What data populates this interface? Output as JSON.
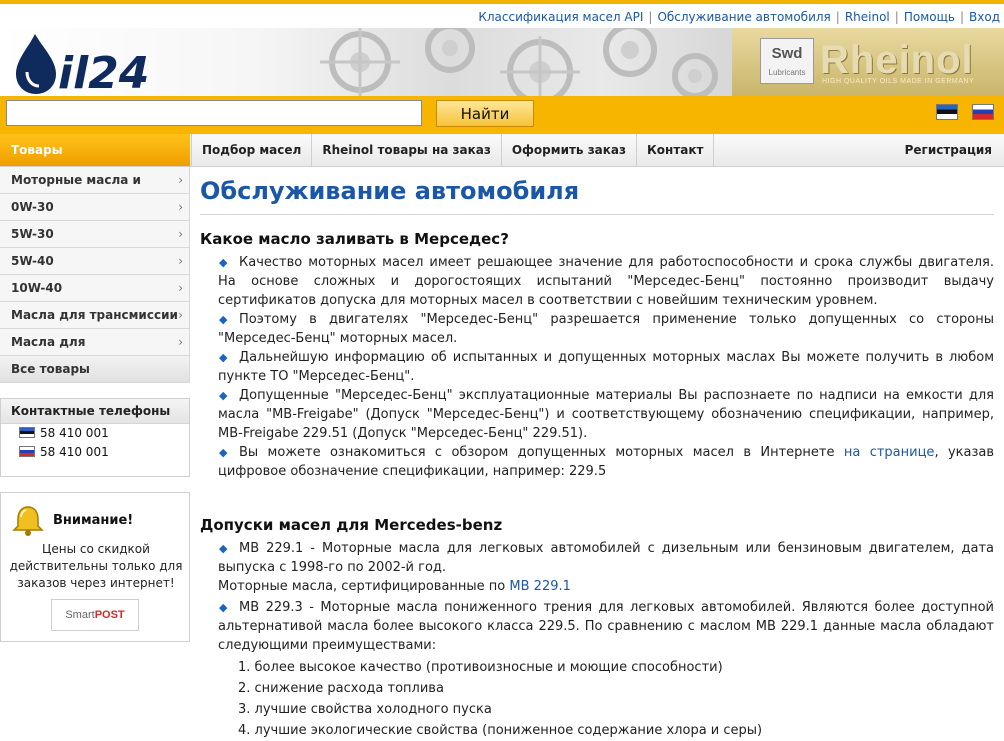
{
  "top_links": [
    "Классификация масел API",
    "Обслуживание автомобиля",
    "Rheinol",
    "Помощь",
    "Вход"
  ],
  "header": {
    "logo_text": "il24",
    "brand_box": "Swd",
    "brand_box_sub": "Lubricants",
    "brand_word": "Rheinol",
    "brand_tagline": "HIGH QUALITY OILS MADE IN GERMANY"
  },
  "search": {
    "value": "",
    "button_label": "Найти"
  },
  "nav": {
    "category_label": "Товары",
    "items": [
      "Подбор масел",
      "Rheinol товары на заказ",
      "Оформить заказ",
      "Контакт"
    ],
    "register_label": "Регистрация"
  },
  "sidebar": {
    "items": [
      "Моторные масла и смазки",
      "0W-30",
      "5W-30",
      "5W-40",
      "10W-40",
      "Масла для трансмиссии",
      "Масла для автоматической"
    ],
    "all_label": "Все товары",
    "chevron": "›"
  },
  "contacts": {
    "title": "Контактные телефоны",
    "phones": [
      "58 410 001",
      "58 410 001"
    ]
  },
  "notice": {
    "title": "Внимание!",
    "text": "Цены со скидкой действительны только для заказов через интернет!",
    "badge_a": "Smart",
    "badge_b": "POST"
  },
  "main": {
    "page_title": "Обслуживание автомобиля",
    "section1_title": "Какое масло заливать в Мерседес?",
    "section1_bullets": [
      "Качество моторных масел имеет решающее значение для работоспособности и срока службы двигателя. На основе сложных и дорогостоящих испытаний \"Мерседес-Бенц\" постоянно производит выдачу сертификатов допуска для моторных масел в соответствии с новейшим техническим уровнем.",
      "Поэтому в двигателях \"Мерседес-Бенц\" разрешается применение только допущенных со стороны \"Мерседес-Бенц\" моторных масел.",
      "Дальнейшую информацию об испытанных и допущенных моторных маслах Вы можете получить в любом пункте ТО \"Мерседес-Бенц\".",
      "Допущенные \"Мерседес-Бенц\" эксплуатационные материалы Вы распознаете по надписи на емкости для масла \"MB-Freigabe\" (Допуск \"Мерседес-Бенц\") и соответствующему обозначению спецификации, например, MB-Freigabe 229.51 (Допуск \"Мерседес-Бенц\" 229.51)."
    ],
    "section1_last_before": "Вы можете ознакомиться с обзором допущенных моторных масел в Интернете ",
    "section1_last_link": "на странице",
    "section1_last_after": ", указав цифровое обозначение спецификации, например: 229.5",
    "section2_title": "Допуски масел для Mercedes-benz",
    "mb2291_text": "MB 229.1 - Моторные масла для легковых автомобилей с дизельным или бензиновым двигателем, дата выпуска с 1998-го по 2002-й год.",
    "mb2291_cert": "Моторные масла, сертифицированные по ",
    "mb2291_link": "MB 229.1",
    "mb2293_text": "MB 229.3 - Моторные масла пониженного трения для легковых автомобилей. Являются более доступной альтернативой масла более высокого класса 229.5. По сравнению с маслом MB 229.1 данные масла обладают следующими преимуществами:",
    "advantages": [
      "1. более высокое качество (противоизносные и моющие способности)",
      "2. снижение расхода топлива",
      "3. лучшие свойства холодного пуска",
      "4. лучшие экологические свойства (пониженное содержание хлора и серы)"
    ]
  },
  "colors": {
    "accent": "#f7b500",
    "link": "#1a57a8",
    "bullet": "#1a63c8"
  }
}
